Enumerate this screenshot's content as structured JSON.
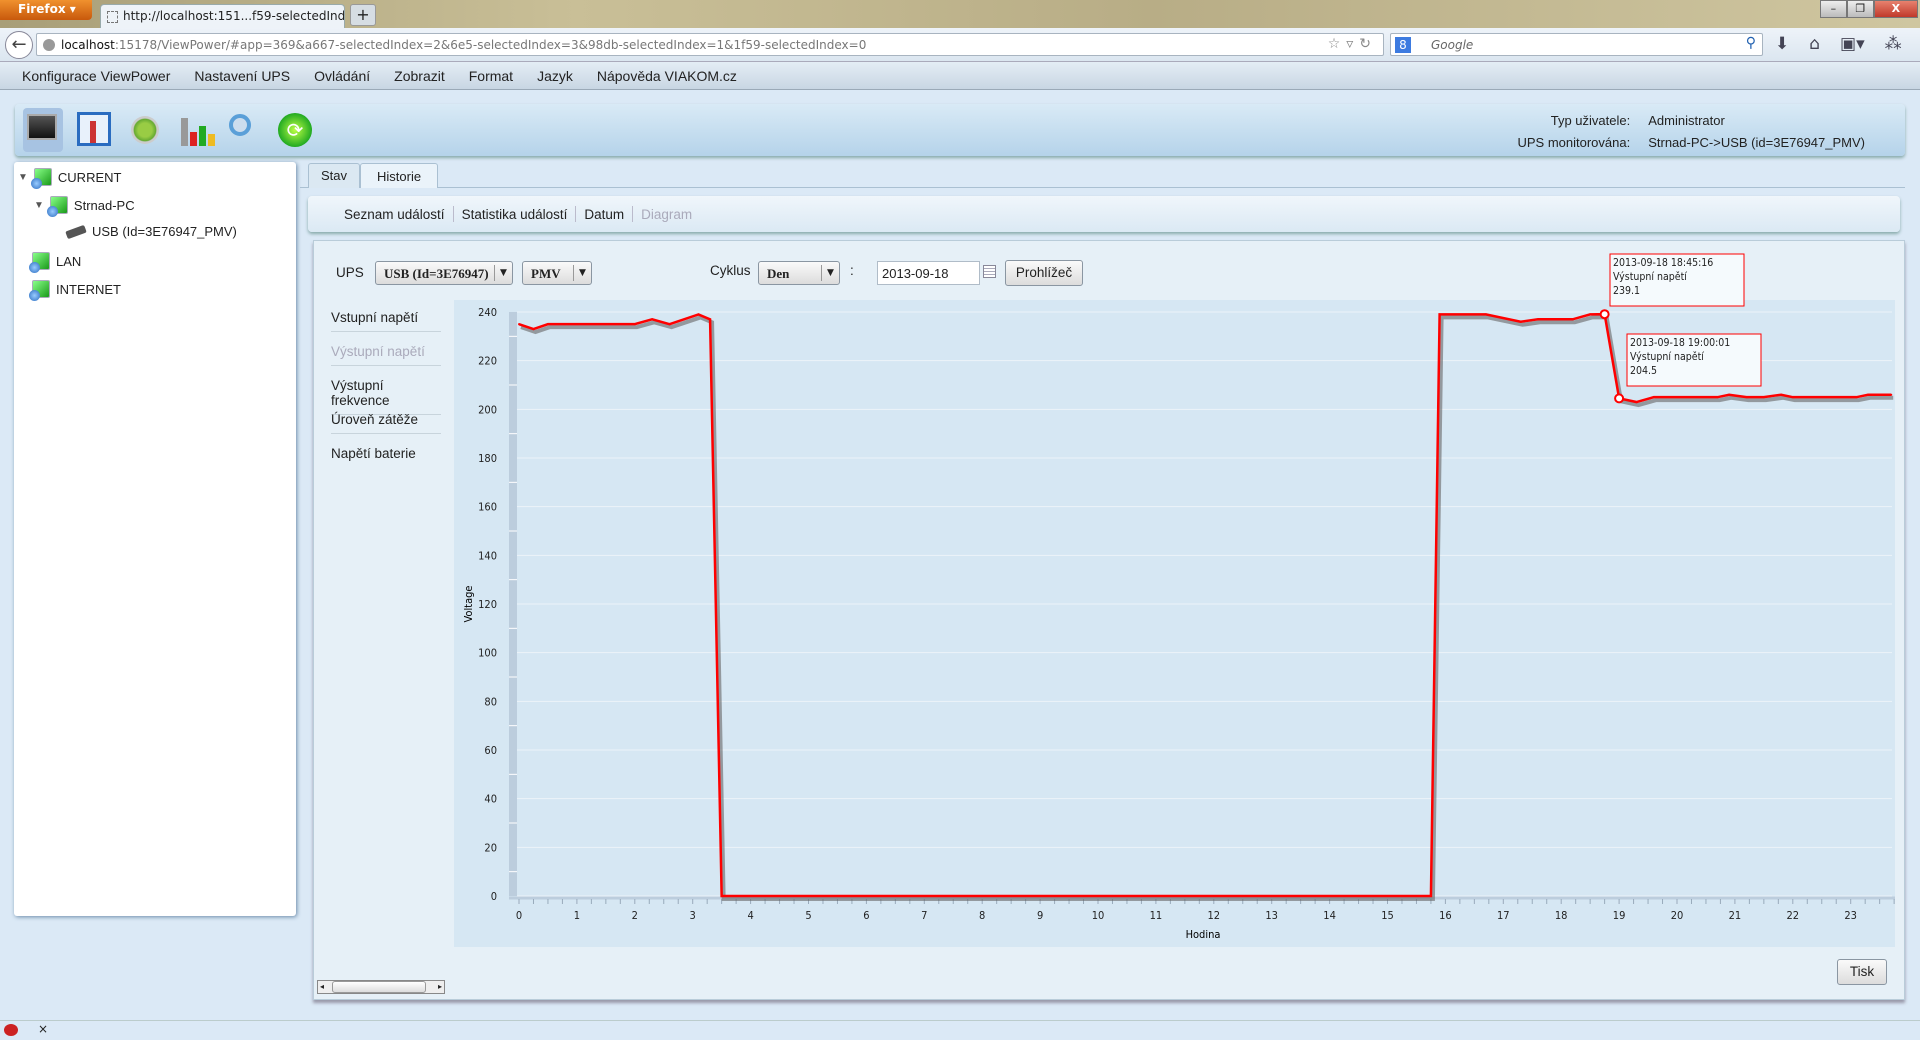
{
  "browser": {
    "brand": "Firefox",
    "tab_title": "http://localhost:151...f59-selectedIndex=0",
    "url_host": "localhost",
    "url_rest": ":15178/ViewPower/#app=369&a667-selectedIndex=2&6e5-selectedIndex=3&98db-selectedIndex=1&1f59-selectedIndex=0",
    "search_placeholder": "Google"
  },
  "menu": [
    "Konfigurace ViewPower",
    "Nastavení UPS",
    "Ovládání",
    "Zobrazit",
    "Format",
    "Jazyk",
    "Nápověda VIAKOM.cz"
  ],
  "user_info": {
    "user_type_label": "Typ uživatele:",
    "user_type": "Administrator",
    "ups_label": "UPS monitorována:",
    "ups_value": "Strnad-PC->USB (id=3E76947_PMV)"
  },
  "tree": {
    "current": "CURRENT",
    "pc": "Strnad-PC",
    "usb": "USB (Id=3E76947_PMV)",
    "lan": "LAN",
    "internet": "INTERNET"
  },
  "tabs": [
    "Stav",
    "Historie"
  ],
  "subtabs": [
    "Seznam událostí",
    "Statistika událostí",
    "Datum",
    "Diagram"
  ],
  "controls": {
    "ups_label": "UPS",
    "ups_select": "USB (Id=3E76947)",
    "model_select": "PMV",
    "cycle_label": "Cyklus",
    "cycle_select": "Den",
    "colon": ":",
    "date": "2013-09-18",
    "browse_button": "Prohlížeč"
  },
  "measures": [
    "Vstupní napětí",
    "Výstupní napětí",
    "Výstupní frekvence",
    "Úroveň zátěže",
    "Napětí baterie"
  ],
  "print_button": "Tisk",
  "colors": {
    "series": "#ff0000",
    "plot_bg": "#d6e7f3"
  },
  "chart_data": {
    "type": "line",
    "xlabel": "Hodina",
    "ylabel": "Voltage",
    "xlim": [
      0,
      23.7
    ],
    "ylim": [
      0,
      240
    ],
    "x_ticks": [
      0,
      1,
      2,
      3,
      4,
      5,
      6,
      7,
      8,
      9,
      10,
      11,
      12,
      13,
      14,
      15,
      16,
      17,
      18,
      19,
      20,
      21,
      22,
      23
    ],
    "y_ticks": [
      0,
      20,
      40,
      60,
      80,
      100,
      120,
      140,
      160,
      180,
      200,
      220,
      240
    ],
    "series": [
      {
        "name": "Výstupní napětí",
        "points": [
          [
            0,
            235
          ],
          [
            0.25,
            233
          ],
          [
            0.5,
            235
          ],
          [
            2,
            235
          ],
          [
            2.3,
            237
          ],
          [
            2.6,
            235
          ],
          [
            3.1,
            239
          ],
          [
            3.3,
            237
          ],
          [
            3.5,
            0
          ],
          [
            15.75,
            0
          ],
          [
            15.9,
            239
          ],
          [
            16.7,
            239
          ],
          [
            17.3,
            236
          ],
          [
            17.6,
            237
          ],
          [
            18.2,
            237
          ],
          [
            18.5,
            239
          ],
          [
            18.75,
            239.1
          ],
          [
            19.0,
            204.5
          ],
          [
            19.3,
            203
          ],
          [
            19.6,
            205
          ],
          [
            20.7,
            205
          ],
          [
            20.9,
            206
          ],
          [
            21.2,
            205
          ],
          [
            21.5,
            205
          ],
          [
            21.8,
            206
          ],
          [
            22.0,
            205
          ],
          [
            23.1,
            205
          ],
          [
            23.3,
            206
          ],
          [
            23.7,
            206
          ]
        ]
      }
    ],
    "annotations": [
      {
        "time": "2013-09-18 18:45:16",
        "label": "Výstupní napětí",
        "value": "239.1",
        "x": 18.75,
        "y": 239.1
      },
      {
        "time": "2013-09-18 19:00:01",
        "label": "Výstupní napětí",
        "value": "204.5",
        "x": 19.0,
        "y": 204.5
      }
    ]
  }
}
